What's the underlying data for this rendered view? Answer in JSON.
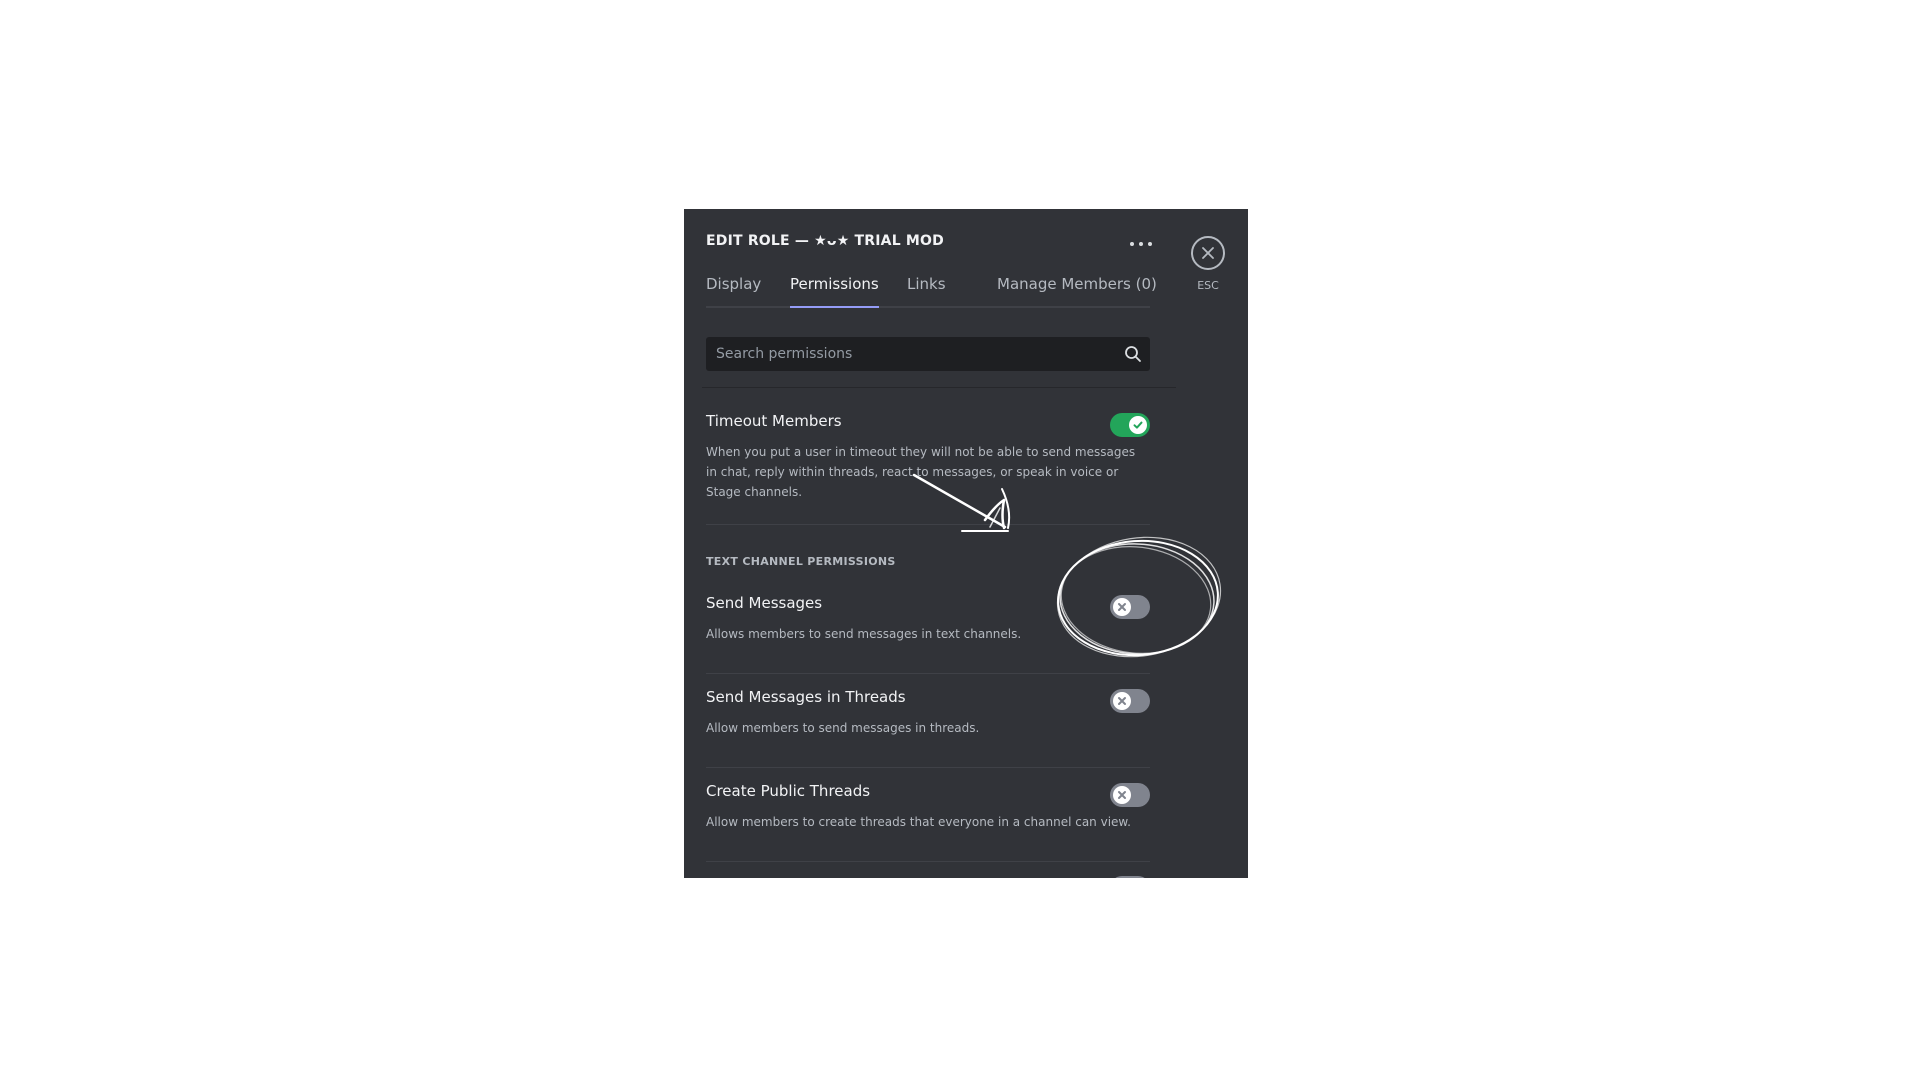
{
  "modal": {
    "title": "EDIT ROLE — ★ᴗ★ TRIAL MOD",
    "more_icon": "more-horizontal-icon"
  },
  "tabs": [
    {
      "label": "Display",
      "active": false
    },
    {
      "label": "Permissions",
      "active": true
    },
    {
      "label": "Links",
      "active": false
    },
    {
      "label": "Manage Members (0)",
      "active": false
    }
  ],
  "search": {
    "placeholder": "Search permissions",
    "value": "",
    "icon": "search-icon"
  },
  "permissions": [
    {
      "name": "Timeout Members",
      "description": "When you put a user in timeout they will not be able to send messages in chat, reply within threads, react to messages, or speak in voice or Stage channels.",
      "enabled": true
    }
  ],
  "text_channel_section": {
    "header": "TEXT CHANNEL PERMISSIONS",
    "items": [
      {
        "name": "Send Messages",
        "description": "Allows members to send messages in text channels.",
        "enabled": false
      },
      {
        "name": "Send Messages in Threads",
        "description": "Allow members to send messages in threads.",
        "enabled": false
      },
      {
        "name": "Create Public Threads",
        "description": "Allow members to create threads that everyone in a channel can view.",
        "enabled": false
      },
      {
        "name": "",
        "description": "",
        "enabled": false
      }
    ]
  },
  "close": {
    "label": "ESC",
    "icon": "close-icon"
  },
  "colors": {
    "panel_bg": "#313338",
    "toggle_on": "#23a55a",
    "toggle_off": "#80848e",
    "tab_active_underline": "#949cf7"
  }
}
